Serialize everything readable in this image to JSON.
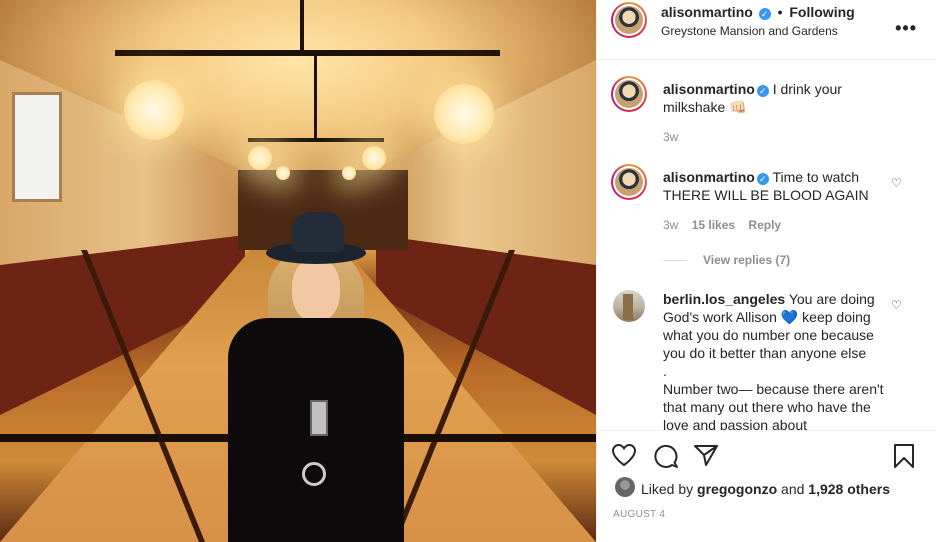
{
  "header": {
    "username": "alisonmartino",
    "separator": "•",
    "follow_status": "Following",
    "location": "Greystone Mansion and Gardens",
    "more_label": "•••"
  },
  "comments": [
    {
      "username": "alisonmartino",
      "text": "I drink your milkshake",
      "emoji": "👊🏻",
      "time": "3w"
    },
    {
      "username": "alisonmartino",
      "text": "Time to watch THERE WILL BE BLOOD AGAIN",
      "time": "3w",
      "likes": "15 likes",
      "reply": "Reply",
      "view_replies": "View replies (7)"
    },
    {
      "username": "berlin.los_angeles",
      "text": "You are doing God's work Allison",
      "emoji": "💙",
      "text2": "keep doing what you do number one because you do it better than anyone else",
      "text3": ".",
      "text4": "Number two— because there aren't that many out there who have the love and passion about"
    }
  ],
  "likes": {
    "prefix": "Liked by",
    "user": "gregogonzo",
    "and": "and",
    "count": "1,928 others"
  },
  "post_date": "AUGUST 4",
  "icons": [
    "heart-icon",
    "comment-icon",
    "share-icon",
    "bookmark-icon",
    "verified-badge-icon"
  ],
  "colors": {
    "verified": "#3897f0",
    "meta": "#8e8e8e",
    "text": "#262626"
  }
}
